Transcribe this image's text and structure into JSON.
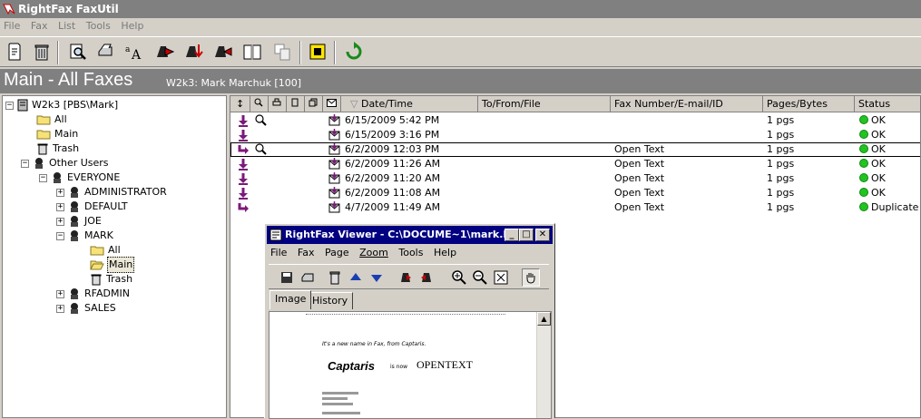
{
  "app": {
    "title": "RightFax FaxUtil"
  },
  "menu": [
    "File",
    "Fax",
    "List",
    "Tools",
    "Help"
  ],
  "toolbar": [
    {
      "icon": "new-fax-icon"
    },
    {
      "icon": "delete-icon"
    },
    {
      "icon": "view-icon"
    },
    {
      "icon": "print-icon"
    },
    {
      "icon": "font-icon"
    },
    {
      "icon": "forward-icon"
    },
    {
      "icon": "route-icon"
    },
    {
      "icon": "resend-icon"
    },
    {
      "icon": "phonebook-icon"
    },
    {
      "icon": "cover-sheet-icon"
    },
    {
      "icon": "fax-machine-icon"
    },
    {
      "icon": "refresh-icon"
    }
  ],
  "header": {
    "title": "Main - All Faxes",
    "subtitle": "W2k3: Mark Marchuk  [100]"
  },
  "tree": {
    "root": "W2k3 [PBS\\Mark]",
    "all": "All",
    "main": "Main",
    "trash": "Trash",
    "other_users": "Other Users",
    "everyone": "EVERYONE",
    "users": [
      "ADMINISTRATOR",
      "DEFAULT",
      "JOE",
      "MARK"
    ],
    "mark_all": "All",
    "mark_main": "Main",
    "mark_trash": "Trash",
    "users_after": [
      "RFADMIN",
      "SALES"
    ]
  },
  "columns": {
    "datetime": "Date/Time",
    "tofrom": "To/From/File",
    "faxnumber": "Fax Number/E-mail/ID",
    "pages": "Pages/Bytes",
    "status": "Status",
    "sort_glyph": "▽"
  },
  "rows": [
    {
      "datetime": "6/15/2009 5:42 PM",
      "tofrom": "",
      "faxnumber": "",
      "pages": "1 pgs",
      "status": "OK"
    },
    {
      "datetime": "6/15/2009 3:16 PM",
      "tofrom": "",
      "faxnumber": "",
      "pages": "1 pgs",
      "status": "OK"
    },
    {
      "datetime": "6/2/2009 12:03 PM",
      "tofrom": "",
      "faxnumber": "Open Text",
      "pages": "1 pgs",
      "status": "OK"
    },
    {
      "datetime": "6/2/2009 11:26 AM",
      "tofrom": "",
      "faxnumber": "Open Text",
      "pages": "1 pgs",
      "status": "OK"
    },
    {
      "datetime": "6/2/2009 11:20 AM",
      "tofrom": "",
      "faxnumber": "Open Text",
      "pages": "1 pgs",
      "status": "OK"
    },
    {
      "datetime": "6/2/2009 11:08 AM",
      "tofrom": "",
      "faxnumber": "Open Text",
      "pages": "1 pgs",
      "status": "OK"
    },
    {
      "datetime": "4/7/2009 11:49 AM",
      "tofrom": "",
      "faxnumber": "Open Text",
      "pages": "1 pgs",
      "status": "Duplicate"
    }
  ],
  "viewer": {
    "title": "RightFax Viewer - C:\\DOCUME~1\\mark.P...",
    "menu": [
      "File",
      "Fax",
      "Page",
      "Zoom",
      "Tools",
      "Help"
    ],
    "tabs": [
      "Image",
      "History"
    ],
    "page": {
      "line1": "It's a new name in Fax, from Captaris.",
      "logo1": "Captaris",
      "mid": "is now",
      "logo2": "OPENTEXT"
    }
  },
  "colors": {
    "accent": "#000080",
    "header_bg": "#808080",
    "ok": "#22c322"
  }
}
